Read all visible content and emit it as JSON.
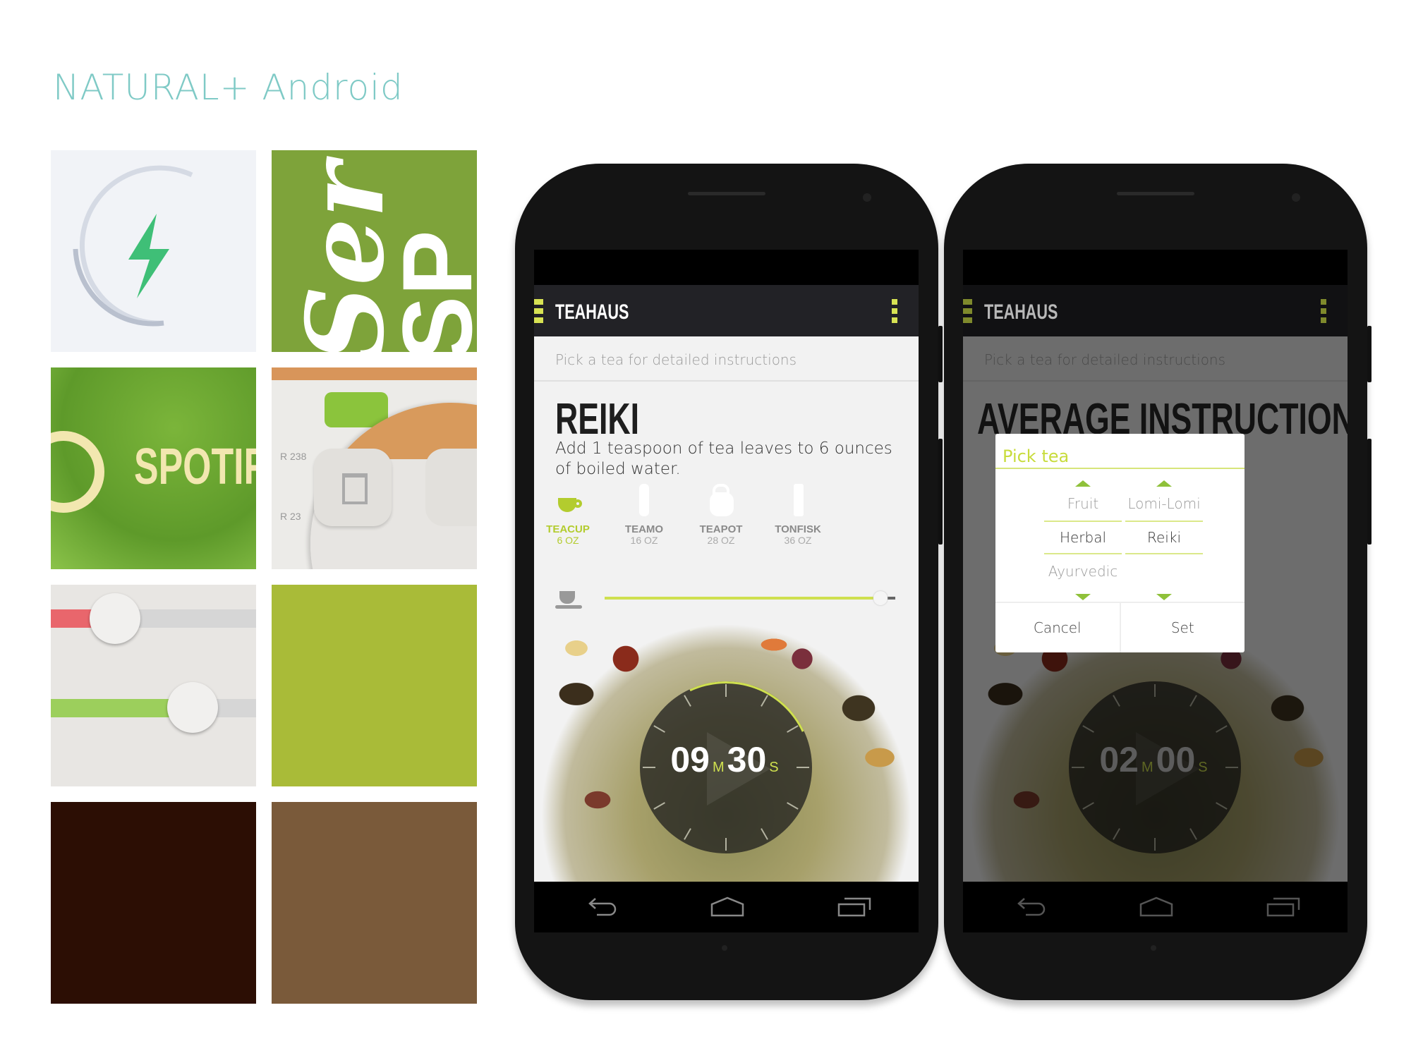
{
  "page_title": "NATURAL+ Android",
  "moodboard": {
    "tile2_text": [
      "Ser",
      "SP"
    ],
    "tile3_text": "SPOTIFY",
    "tile4_labels": [
      "R 238",
      "R 23"
    ],
    "swatches": {
      "lime": "#a9bb38",
      "dark_brown": "#2c0e04",
      "brown": "#7a5a3a"
    }
  },
  "accent": "#cfe04f",
  "phone1": {
    "app_title": "TEAHAUS",
    "subheader": "Pick a tea for detailed instructions",
    "heading": "REIKI",
    "description": "Add 1 teaspoon of tea leaves to 6 ounces of boiled water.",
    "vessels": [
      {
        "name": "TEACUP",
        "size": "6 OZ",
        "active": true
      },
      {
        "name": "TEAMO",
        "size": "16 OZ"
      },
      {
        "name": "TEAPOT",
        "size": "28 OZ"
      },
      {
        "name": "TONFISK",
        "size": "36 OZ"
      }
    ],
    "slider_value": 0.95,
    "timer": {
      "minutes": "09",
      "min_unit": "M",
      "seconds": "30",
      "sec_unit": "S"
    }
  },
  "phone2": {
    "app_title": "TEAHAUS",
    "subheader": "Pick a tea for detailed instructions",
    "heading": "AVERAGE INSTRUCTIONS",
    "timer": {
      "minutes": "02",
      "min_unit": "M",
      "seconds": "00",
      "sec_unit": "S"
    },
    "dialog": {
      "title": "Pick tea",
      "column1": {
        "above": "Fruit",
        "selected": "Herbal",
        "below": "Ayurvedic"
      },
      "column2": {
        "above": "Lomi-Lomi",
        "selected": "Reiki",
        "below": ""
      },
      "cancel": "Cancel",
      "set": "Set"
    }
  }
}
